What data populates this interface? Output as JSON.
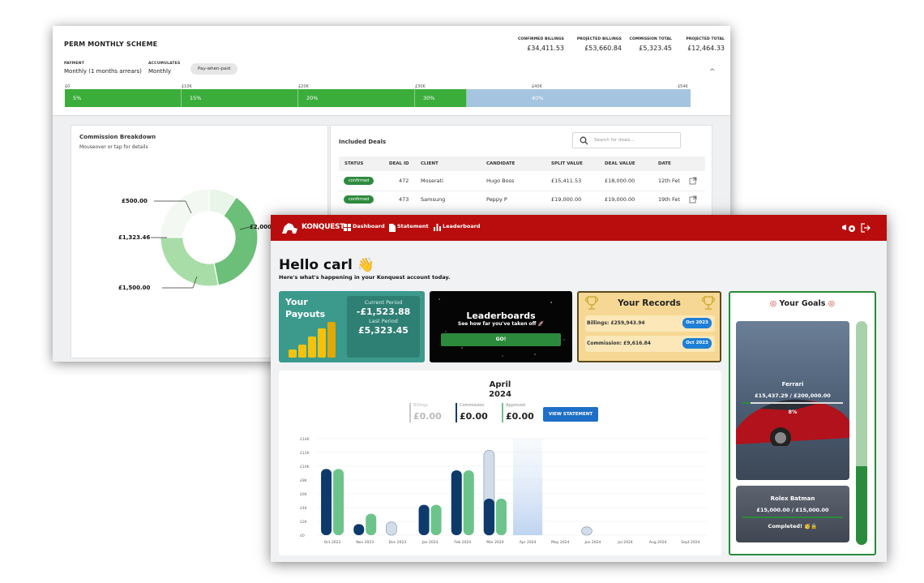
{
  "scheme": {
    "title": "PERM MONTHLY SCHEME",
    "payment_label": "PAYMENT",
    "payment_value": "Monthly (1 months arrears)",
    "accumulates_label": "ACCUMULATES",
    "accumulates_value": "Monthly",
    "pill": "Pay-when-paid",
    "totals": [
      {
        "label": "CONFIRMED BILLINGS",
        "value": "£34,411.53"
      },
      {
        "label": "PROJECTED BILLINGS",
        "value": "£53,660.84"
      },
      {
        "label": "COMMISSION TOTAL",
        "value": "£5,323.45"
      },
      {
        "label": "PROJECTED TOTAL",
        "value": "£12,464.33"
      }
    ],
    "ticks": [
      "£0",
      "£10K",
      "£20K",
      "£30K",
      "£40K",
      "£54K"
    ],
    "bands": [
      "5%",
      "15%",
      "20%",
      "30%",
      "40%"
    ],
    "confirmed_fraction": 0.64
  },
  "breakdown": {
    "title": "Commission Breakdown",
    "subtitle": "Mouseover or tap for details",
    "labels": [
      "£500.00",
      "£2,000.",
      "£1,323.46",
      "£1,500.00"
    ],
    "slices": [
      500,
      2000,
      1500,
      1323.46
    ]
  },
  "deals": {
    "title": "Included Deals",
    "search_placeholder": "Search for deals...",
    "columns": [
      "STATUS",
      "DEAL ID",
      "CLIENT",
      "CANDIDATE",
      "SPLIT VALUE",
      "DEAL VALUE",
      "DATE"
    ],
    "rows": [
      {
        "status": "confirmed",
        "id": "472",
        "client": "Moserati",
        "candidate": "Hugo Boss",
        "split": "£15,411.53",
        "value": "£18,000.00",
        "date": "12th Fet"
      },
      {
        "status": "confirmed",
        "id": "473",
        "client": "Samsung",
        "candidate": "Peppy P",
        "split": "£19,000.00",
        "value": "£19,000.00",
        "date": "19th Fet"
      }
    ]
  },
  "app": {
    "logo": "KONQUEST",
    "nav": [
      "Dashboard",
      "Statement",
      "Leaderboard"
    ],
    "hello": "Hello carl 👋",
    "subtitle": "Here's what's happening in your Konquest account today.",
    "payouts": {
      "title1": "Your",
      "title2": "Payouts",
      "current_label": "Current Period",
      "current_value": "-£1,523.88",
      "last_label": "Last Period",
      "last_value": "£5,323.45"
    },
    "leaderboards": {
      "title": "Leaderboards",
      "subtitle": "See how far you've taken off 🚀",
      "button": "GO!"
    },
    "records": {
      "title": "Your Records",
      "billings_label": "Billings:",
      "billings_value": "£259,943.94",
      "billings_date": "Oct 2023",
      "commission_label": "Commission:",
      "commission_value": "£9,616.84",
      "commission_date": "Oct 2023"
    },
    "goals": {
      "title": "Your Goals",
      "progress": 0.35,
      "items": [
        {
          "name": "Ferrari",
          "amount": "£15,437.29  /  £200,000.00",
          "pct": "8%",
          "fraction": 0.08
        },
        {
          "name": "Rolex Batman",
          "amount": "£15,000.00  /  £15,000.00",
          "pct": "Completed! 🥳🔒",
          "fraction": 1.0
        }
      ]
    }
  },
  "statement": {
    "month": "April",
    "year": "2024",
    "billings_label": "Billings",
    "billings_value": "£0.00",
    "commission_label": "Commission",
    "commission_value": "£0.00",
    "approved_label": "Approved",
    "approved_value": "£0.00",
    "button": "VIEW STATEMENT"
  },
  "colors": {
    "nav_red": "#b90d0d",
    "dark_blue": "#0e3a6b",
    "green": "#6cc48a",
    "pale": "#c9d6e4",
    "teal": "#3b9a8c",
    "gold": "#f6d894"
  },
  "chart_data": {
    "type": "bar",
    "categories": [
      "Oct 2023",
      "Nov 2023",
      "Dec 2023",
      "Jan 2024",
      "Feb 2024",
      "Mar 2024",
      "Apr 2024",
      "May 2024",
      "Jun 2024",
      "Jul 2024",
      "Aug 2024",
      "Sept 2024"
    ],
    "yticks": [
      "£0",
      "£2K",
      "£4K",
      "£6K",
      "£8K",
      "£10K",
      "£12K",
      "£14K"
    ],
    "ylim": [
      0,
      14000
    ],
    "series": [
      {
        "name": "Commission",
        "values": [
          9600,
          1600,
          0,
          4400,
          9400,
          5300,
          0,
          0,
          0,
          0,
          0,
          0
        ]
      },
      {
        "name": "Approved",
        "values": [
          9600,
          3100,
          0,
          4400,
          9400,
          5300,
          0,
          0,
          0,
          0,
          0,
          0
        ]
      },
      {
        "name": "Billings",
        "values": [
          0,
          0,
          1900,
          0,
          0,
          12300,
          0,
          0,
          1200,
          0,
          0,
          0
        ]
      }
    ],
    "highlight": "Apr 2024"
  }
}
